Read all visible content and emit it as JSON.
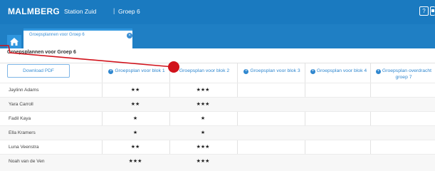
{
  "topbar": {
    "logo": "MALMBERG",
    "school": "Station Zuid",
    "separator": "|",
    "group": "Groep 6",
    "help_label": "?"
  },
  "tab": {
    "label": "Groepsplannen voor Groep 6",
    "close_label": "×"
  },
  "page": {
    "title": "Groepsplannen voor Groep 6",
    "download_label": "Download PDF"
  },
  "columns": [
    "Groepsplan voor blok 1",
    "Groepsplan voor blok 2",
    "Groepsplan voor blok 3",
    "Groepsplan voor blok 4",
    "Groepsplan overdracht groep 7"
  ],
  "rows": [
    {
      "name": "Jaylinn Adams",
      "blok1": "★★",
      "blok2": "★★★"
    },
    {
      "name": "Yara Carroll",
      "blok1": "★★",
      "blok2": "★★★"
    },
    {
      "name": "Fadil Kaya",
      "blok1": "★",
      "blok2": "★"
    },
    {
      "name": "Ella Kramers",
      "blok1": "★",
      "blok2": "★"
    },
    {
      "name": "Luna Veenstra",
      "blok1": "★★",
      "blok2": "★★★"
    },
    {
      "name": "Noah van de Ven",
      "blok1": "★★★",
      "blok2": "★★★"
    }
  ],
  "colors": {
    "brand_blue": "#1a7ac0",
    "link_blue": "#2f87cf",
    "annotation_red": "#d1121b"
  }
}
